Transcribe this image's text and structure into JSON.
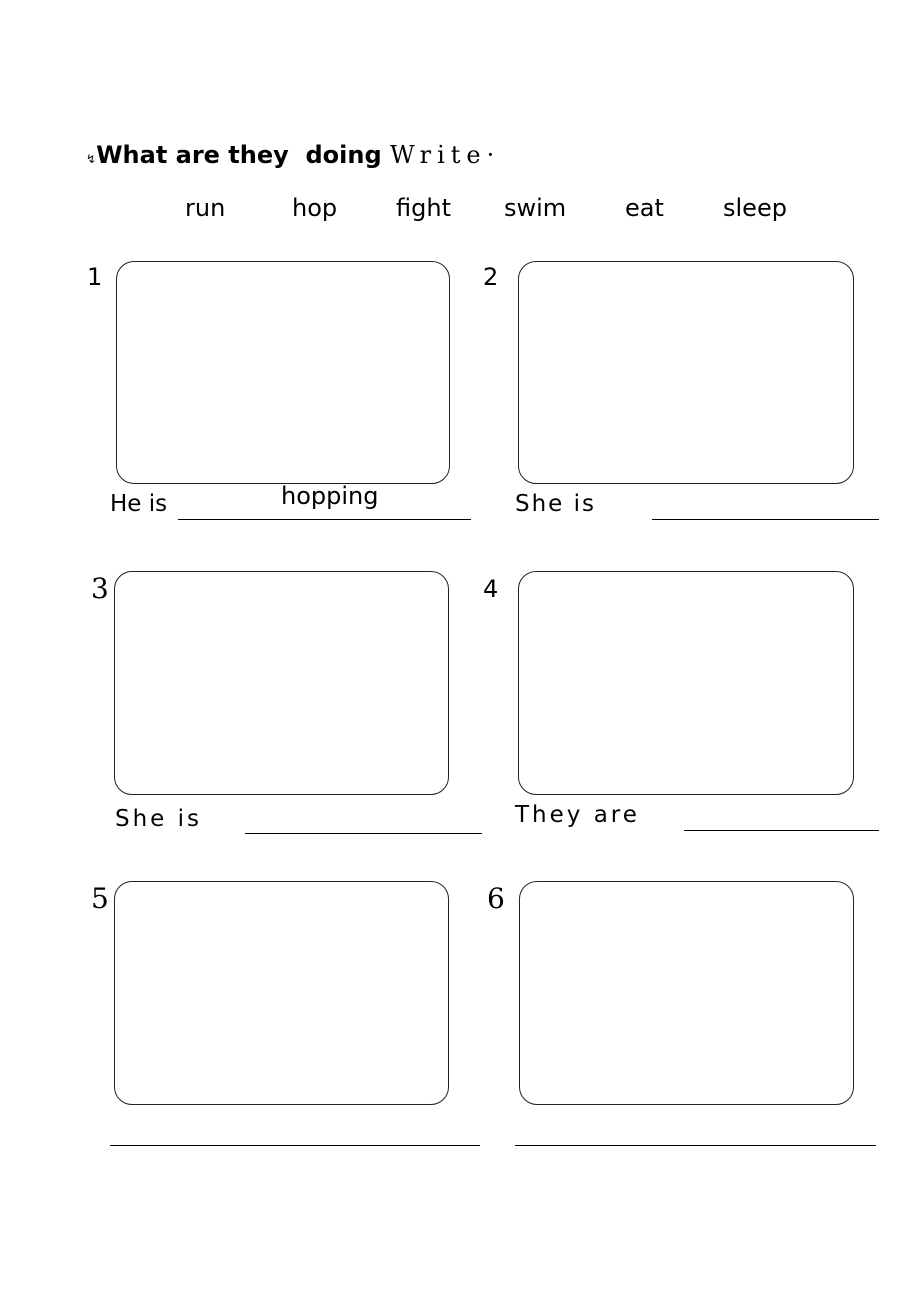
{
  "title": {
    "main": "What are they  doing",
    "suffix": "Write·"
  },
  "word_bank": [
    "run",
    "hop",
    "fight",
    "swim",
    "eat",
    "sleep"
  ],
  "items": [
    {
      "number": "1",
      "sentence": "He is",
      "answer": "hopping"
    },
    {
      "number": "2",
      "sentence": "She is",
      "answer": ""
    },
    {
      "number": "3",
      "sentence": "She is",
      "answer": ""
    },
    {
      "number": "4",
      "sentence": "They are",
      "answer": ""
    },
    {
      "number": "5",
      "sentence": "",
      "answer": ""
    },
    {
      "number": "6",
      "sentence": "",
      "answer": ""
    }
  ]
}
